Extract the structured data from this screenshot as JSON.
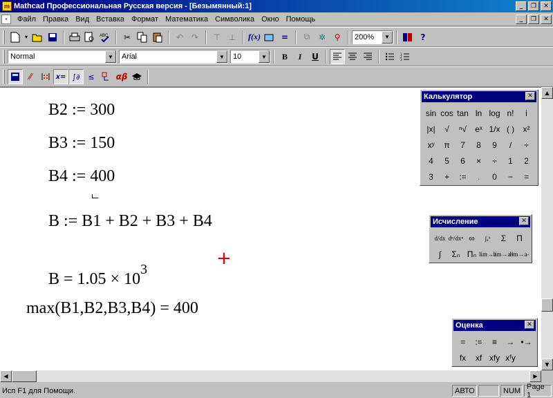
{
  "window": {
    "title": "Mathcad Профессиональная Русская версия - [Безымянный:1]",
    "btn_min": "_",
    "btn_max": "❐",
    "btn_close": "✕"
  },
  "menu": {
    "items": [
      "Файл",
      "Правка",
      "Вид",
      "Вставка",
      "Формат",
      "Математика",
      "Символика",
      "Окно",
      "Помощь"
    ]
  },
  "toolbar": {
    "zoom": "200%"
  },
  "format_toolbar": {
    "style": "Normal",
    "font": "Arial",
    "size": "10",
    "bold": "B",
    "italic": "I",
    "underline": "U"
  },
  "math_toolbar": {
    "icon_names": [
      "calculator-icon",
      "graph-icon",
      "matrix-icon",
      "evaluation-icon",
      "calculus-icon",
      "boolean-icon",
      "programming-icon",
      "greek-icon",
      "symbolic-icon"
    ]
  },
  "worksheet": {
    "rows": [
      {
        "name": "def-b2",
        "text": "B2 :=  300"
      },
      {
        "name": "def-b3",
        "text": "B3 :=  150"
      },
      {
        "name": "def-b4",
        "text": "B4 :=  400"
      },
      {
        "name": "def-b",
        "text": "B :=  B1 + B2 + B3 + B4"
      },
      {
        "name": "result-b",
        "mantissa": "B  =  1.05 × 10",
        "exponent": "3"
      },
      {
        "name": "result-max",
        "text": "max(B1,B2,B3,B4)  =  400"
      }
    ],
    "crosshair": "+"
  },
  "palettes": {
    "calculator": {
      "title": "Калькулятор",
      "buttons": [
        "sin",
        "cos",
        "tan",
        "ln",
        "log",
        "n!",
        "i",
        "|x|",
        "√",
        "ⁿ√",
        "eˣ",
        "1/x",
        "( )",
        "x²",
        "xʸ",
        "π",
        "7",
        "8",
        "9",
        "/",
        "÷",
        "4",
        "5",
        "6",
        "×",
        "÷",
        "1",
        "2",
        "3",
        "+",
        ":=",
        ".",
        "0",
        "−",
        "="
      ]
    },
    "calculus": {
      "title": "Исчисление",
      "buttons": [
        "d/dx",
        "dⁿ/dxⁿ",
        "∞",
        "∫ₐᵇ",
        "Σ",
        "Π",
        "∫",
        "Σₙ",
        "Πₙ",
        "lim→a",
        "lim→a+",
        "lim→a-"
      ]
    },
    "evaluation": {
      "title": "Оценка",
      "buttons": [
        "=",
        ":=",
        "≡",
        "→",
        "•→",
        "fx",
        "xf",
        "xfy",
        "xᶠy"
      ]
    },
    "close": "✕"
  },
  "statusbar": {
    "message": "Исп F1 для Помощи.",
    "mode": "АВТО",
    "num": "NUM",
    "page": "Page 1"
  }
}
